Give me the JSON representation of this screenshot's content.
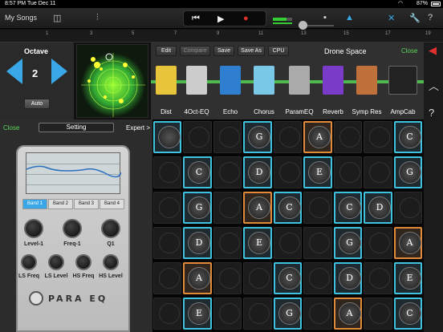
{
  "status": {
    "time": "8:57 PM",
    "date": "Tue Dec 11",
    "battery": "87%"
  },
  "toolbar": {
    "my_songs": "My Songs"
  },
  "ruler": {
    "ticks": [
      "1",
      "3",
      "5",
      "7",
      "9",
      "11",
      "13",
      "15",
      "17",
      "19"
    ]
  },
  "octave": {
    "label": "Octave",
    "value": "2",
    "auto": "Auto"
  },
  "plugins": {
    "buttons": [
      "Edit",
      "Compare",
      "Save",
      "Save As",
      "CPU"
    ],
    "preset": "Drone Space",
    "close": "Close",
    "chain": [
      "Dist",
      "4Oct-EQ",
      "Echo",
      "Chorus",
      "ParamEQ",
      "Reverb",
      "Symp Res",
      "AmpCab"
    ]
  },
  "eq": {
    "close": "Close",
    "setting": "Setting",
    "expert": "Expert >",
    "bands": [
      "Band 1",
      "Band 2",
      "Band 3",
      "Band 4"
    ],
    "active_band": "Band 1",
    "knobs": [
      "Level-1",
      "Freq-1",
      "Q1",
      "LS Freq",
      "LS Level",
      "HS Freq",
      "HS Level"
    ],
    "logo": "PARA EQ"
  },
  "grid": {
    "notes": [
      {
        "row": 0,
        "col": 0,
        "label": "",
        "color": "cyan"
      },
      {
        "row": 0,
        "col": 3,
        "label": "G",
        "color": "cyan"
      },
      {
        "row": 0,
        "col": 5,
        "label": "A",
        "color": "orange"
      },
      {
        "row": 0,
        "col": 8,
        "label": "C",
        "color": "cyan"
      },
      {
        "row": 1,
        "col": 1,
        "label": "C",
        "color": "cyan"
      },
      {
        "row": 1,
        "col": 3,
        "label": "D",
        "color": "cyan"
      },
      {
        "row": 1,
        "col": 5,
        "label": "E",
        "color": "cyan"
      },
      {
        "row": 1,
        "col": 8,
        "label": "G",
        "color": "cyan"
      },
      {
        "row": 2,
        "col": 1,
        "label": "G",
        "color": "cyan"
      },
      {
        "row": 2,
        "col": 3,
        "label": "A",
        "color": "orange"
      },
      {
        "row": 2,
        "col": 4,
        "label": "C",
        "color": "cyan"
      },
      {
        "row": 2,
        "col": 6,
        "label": "C",
        "color": "cyan"
      },
      {
        "row": 2,
        "col": 7,
        "label": "D",
        "color": "cyan"
      },
      {
        "row": 3,
        "col": 1,
        "label": "D",
        "color": "cyan"
      },
      {
        "row": 3,
        "col": 3,
        "label": "E",
        "color": "cyan"
      },
      {
        "row": 3,
        "col": 6,
        "label": "G",
        "color": "cyan"
      },
      {
        "row": 3,
        "col": 8,
        "label": "A",
        "color": "orange"
      },
      {
        "row": 4,
        "col": 1,
        "label": "A",
        "color": "orange"
      },
      {
        "row": 4,
        "col": 4,
        "label": "C",
        "color": "cyan"
      },
      {
        "row": 4,
        "col": 6,
        "label": "D",
        "color": "cyan"
      },
      {
        "row": 4,
        "col": 8,
        "label": "E",
        "color": "cyan"
      },
      {
        "row": 5,
        "col": 1,
        "label": "E",
        "color": "cyan"
      },
      {
        "row": 5,
        "col": 4,
        "label": "G",
        "color": "cyan"
      },
      {
        "row": 5,
        "col": 6,
        "label": "A",
        "color": "orange"
      },
      {
        "row": 5,
        "col": 8,
        "label": "C",
        "color": "cyan"
      }
    ]
  }
}
